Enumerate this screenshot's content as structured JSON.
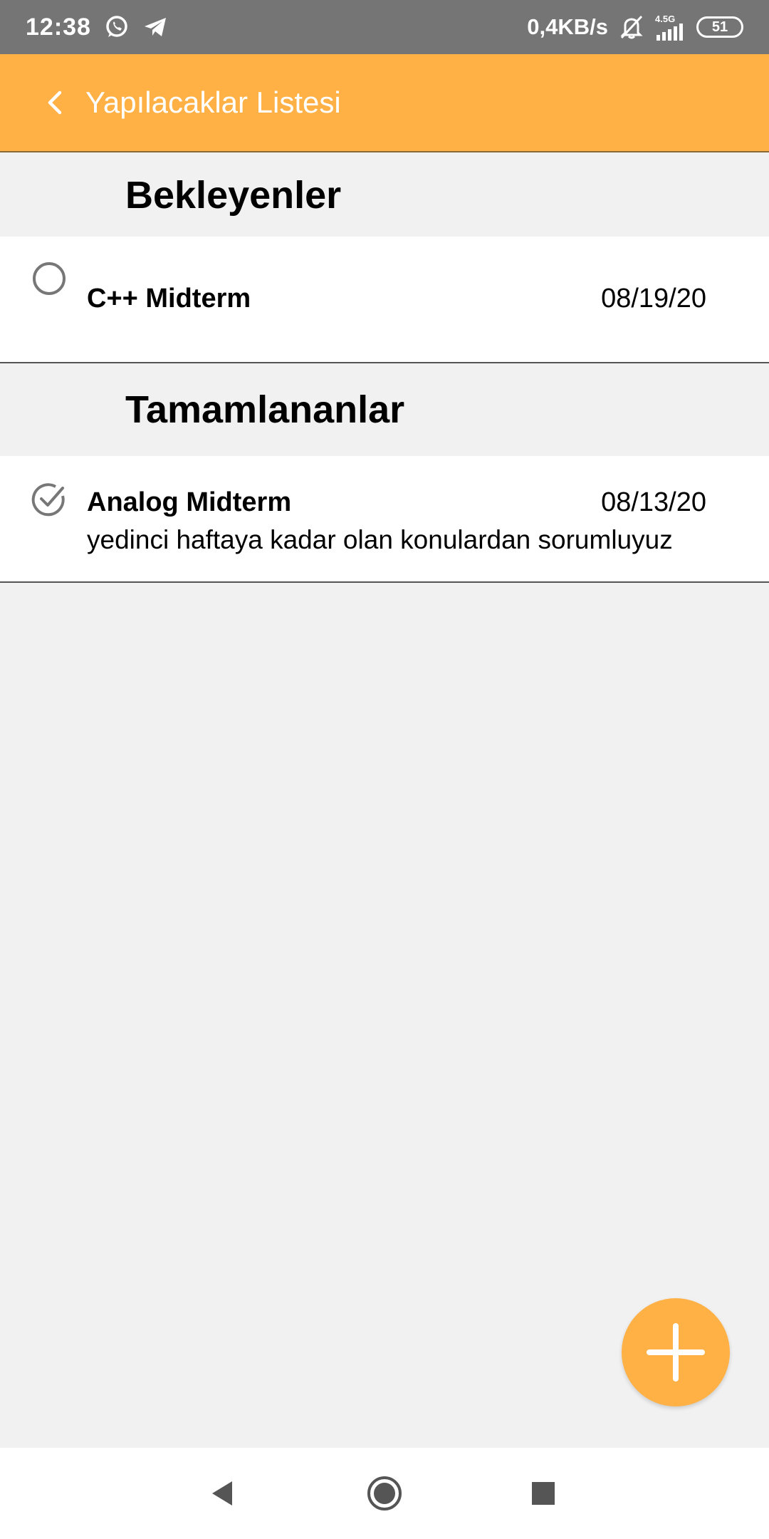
{
  "status_bar": {
    "time": "12:38",
    "network_speed": "0,4KB/s",
    "network_type": "4.5G",
    "battery": "51",
    "icons": [
      "whatsapp-icon",
      "telegram-icon",
      "mute-icon",
      "signal-icon",
      "battery-icon"
    ]
  },
  "app_bar": {
    "title": "Yapılacaklar Listesi",
    "back_icon": "chevron-left-icon",
    "color": "#ffb146"
  },
  "sections": {
    "pending": {
      "header": "Bekleyenler",
      "items": [
        {
          "title": "C++ Midterm",
          "date": "08/19/20",
          "description": "",
          "checked": false
        }
      ]
    },
    "completed": {
      "header": "Tamamlananlar",
      "items": [
        {
          "title": "Analog Midterm",
          "date": "08/13/20",
          "description": "yedinci haftaya kadar olan konulardan sorumluyuz",
          "checked": true
        }
      ]
    }
  },
  "fab": {
    "icon": "plus-icon",
    "color": "#ffb146"
  },
  "nav_bar": {
    "icons": [
      "back-triangle-icon",
      "home-circle-icon",
      "recents-square-icon"
    ]
  }
}
